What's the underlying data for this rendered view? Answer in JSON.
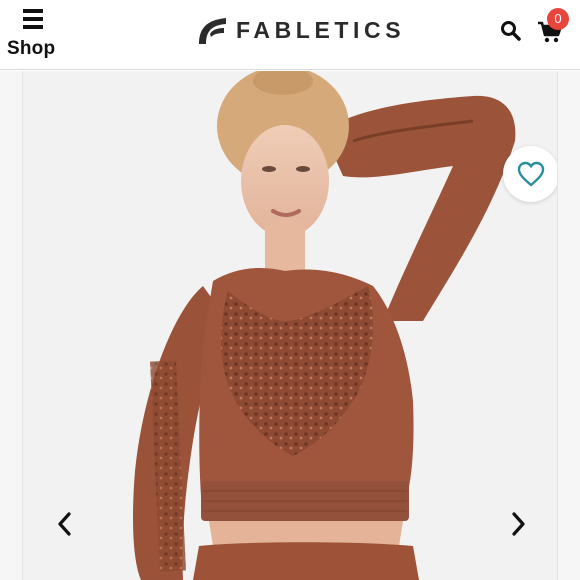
{
  "header": {
    "menu_label": "Shop",
    "brand": "FABLETICS",
    "cart_count": "0"
  },
  "icons": {
    "menu": "hamburger-icon",
    "logo": "fabletics-logo-mark",
    "search": "search-icon",
    "cart": "cart-icon",
    "favorite": "heart-icon",
    "prev": "chevron-left-icon",
    "next": "chevron-right-icon"
  },
  "gallery": {
    "image_description": "Model wearing a brown long-sleeve lace-cutout crop top"
  },
  "colors": {
    "accent_teal": "#2a8f9c",
    "badge_red": "#e8453c",
    "product_brown": "#a0563c"
  }
}
